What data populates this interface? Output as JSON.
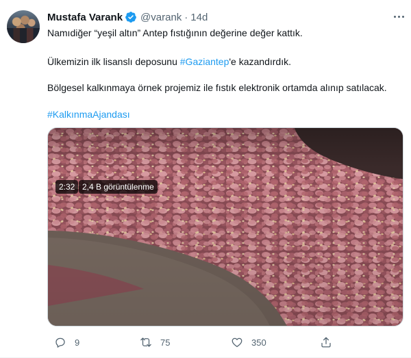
{
  "tweet": {
    "author_name": "Mustafa Varank",
    "handle": "@varank",
    "separator": "·",
    "time": "14d",
    "line1": "Namıdiğer “yeşil altın” Antep fıstığının değerine değer kattık.",
    "line2_before": "Ülkemizin ilk lisanslı deposunu ",
    "line2_link": "#Gaziantep",
    "line2_after": "'e kazandırdık.",
    "line3": "Bölgesel kalkınmaya örnek projemiz ile fıstık elektronik ortamda alınıp satılacak.",
    "hashtag": "#KalkınmaAjandası"
  },
  "video": {
    "duration": "2:32",
    "views": "2,4 B görüntülenme"
  },
  "actions": {
    "reply_count": "9",
    "retweet_count": "75",
    "like_count": "350"
  },
  "icons": {
    "verified": "verified-badge-icon",
    "reply": "reply-icon",
    "retweet": "retweet-icon",
    "like": "heart-icon",
    "share": "share-icon",
    "more": "more-icon"
  },
  "colors": {
    "accent": "#1d9bf0",
    "text": "#0f1419",
    "muted": "#536471"
  }
}
